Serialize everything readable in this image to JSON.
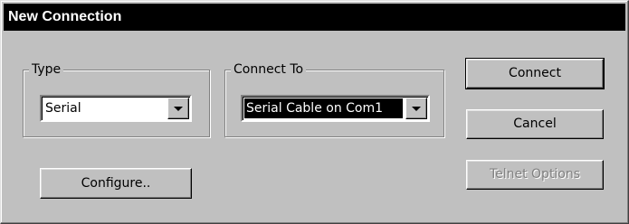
{
  "window": {
    "title": "New Connection"
  },
  "type_group": {
    "label": "Type",
    "value": "Serial"
  },
  "connect_group": {
    "label": "Connect To",
    "value": "Serial Cable on Com1"
  },
  "buttons": {
    "connect": "Connect",
    "cancel": "Cancel",
    "telnet_options": "Telnet Options",
    "configure": "Configure.."
  }
}
